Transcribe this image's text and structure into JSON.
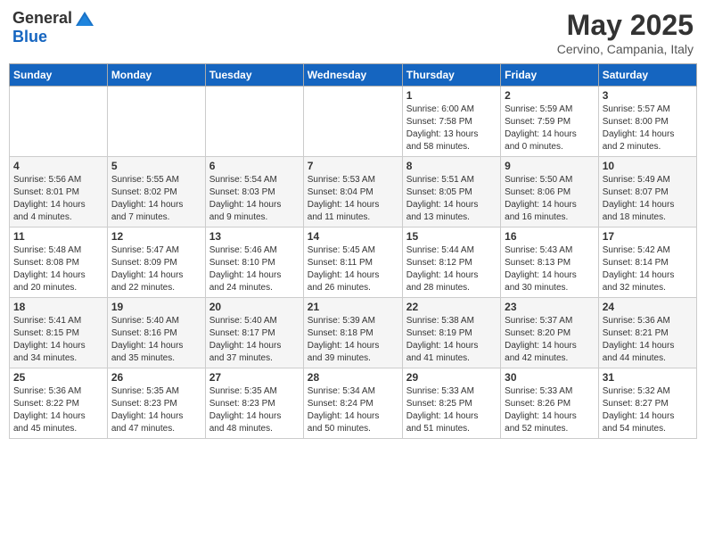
{
  "header": {
    "logo_general": "General",
    "logo_blue": "Blue",
    "month": "May 2025",
    "location": "Cervino, Campania, Italy"
  },
  "days_of_week": [
    "Sunday",
    "Monday",
    "Tuesday",
    "Wednesday",
    "Thursday",
    "Friday",
    "Saturday"
  ],
  "weeks": [
    [
      {
        "num": "",
        "info": ""
      },
      {
        "num": "",
        "info": ""
      },
      {
        "num": "",
        "info": ""
      },
      {
        "num": "",
        "info": ""
      },
      {
        "num": "1",
        "info": "Sunrise: 6:00 AM\nSunset: 7:58 PM\nDaylight: 13 hours\nand 58 minutes."
      },
      {
        "num": "2",
        "info": "Sunrise: 5:59 AM\nSunset: 7:59 PM\nDaylight: 14 hours\nand 0 minutes."
      },
      {
        "num": "3",
        "info": "Sunrise: 5:57 AM\nSunset: 8:00 PM\nDaylight: 14 hours\nand 2 minutes."
      }
    ],
    [
      {
        "num": "4",
        "info": "Sunrise: 5:56 AM\nSunset: 8:01 PM\nDaylight: 14 hours\nand 4 minutes."
      },
      {
        "num": "5",
        "info": "Sunrise: 5:55 AM\nSunset: 8:02 PM\nDaylight: 14 hours\nand 7 minutes."
      },
      {
        "num": "6",
        "info": "Sunrise: 5:54 AM\nSunset: 8:03 PM\nDaylight: 14 hours\nand 9 minutes."
      },
      {
        "num": "7",
        "info": "Sunrise: 5:53 AM\nSunset: 8:04 PM\nDaylight: 14 hours\nand 11 minutes."
      },
      {
        "num": "8",
        "info": "Sunrise: 5:51 AM\nSunset: 8:05 PM\nDaylight: 14 hours\nand 13 minutes."
      },
      {
        "num": "9",
        "info": "Sunrise: 5:50 AM\nSunset: 8:06 PM\nDaylight: 14 hours\nand 16 minutes."
      },
      {
        "num": "10",
        "info": "Sunrise: 5:49 AM\nSunset: 8:07 PM\nDaylight: 14 hours\nand 18 minutes."
      }
    ],
    [
      {
        "num": "11",
        "info": "Sunrise: 5:48 AM\nSunset: 8:08 PM\nDaylight: 14 hours\nand 20 minutes."
      },
      {
        "num": "12",
        "info": "Sunrise: 5:47 AM\nSunset: 8:09 PM\nDaylight: 14 hours\nand 22 minutes."
      },
      {
        "num": "13",
        "info": "Sunrise: 5:46 AM\nSunset: 8:10 PM\nDaylight: 14 hours\nand 24 minutes."
      },
      {
        "num": "14",
        "info": "Sunrise: 5:45 AM\nSunset: 8:11 PM\nDaylight: 14 hours\nand 26 minutes."
      },
      {
        "num": "15",
        "info": "Sunrise: 5:44 AM\nSunset: 8:12 PM\nDaylight: 14 hours\nand 28 minutes."
      },
      {
        "num": "16",
        "info": "Sunrise: 5:43 AM\nSunset: 8:13 PM\nDaylight: 14 hours\nand 30 minutes."
      },
      {
        "num": "17",
        "info": "Sunrise: 5:42 AM\nSunset: 8:14 PM\nDaylight: 14 hours\nand 32 minutes."
      }
    ],
    [
      {
        "num": "18",
        "info": "Sunrise: 5:41 AM\nSunset: 8:15 PM\nDaylight: 14 hours\nand 34 minutes."
      },
      {
        "num": "19",
        "info": "Sunrise: 5:40 AM\nSunset: 8:16 PM\nDaylight: 14 hours\nand 35 minutes."
      },
      {
        "num": "20",
        "info": "Sunrise: 5:40 AM\nSunset: 8:17 PM\nDaylight: 14 hours\nand 37 minutes."
      },
      {
        "num": "21",
        "info": "Sunrise: 5:39 AM\nSunset: 8:18 PM\nDaylight: 14 hours\nand 39 minutes."
      },
      {
        "num": "22",
        "info": "Sunrise: 5:38 AM\nSunset: 8:19 PM\nDaylight: 14 hours\nand 41 minutes."
      },
      {
        "num": "23",
        "info": "Sunrise: 5:37 AM\nSunset: 8:20 PM\nDaylight: 14 hours\nand 42 minutes."
      },
      {
        "num": "24",
        "info": "Sunrise: 5:36 AM\nSunset: 8:21 PM\nDaylight: 14 hours\nand 44 minutes."
      }
    ],
    [
      {
        "num": "25",
        "info": "Sunrise: 5:36 AM\nSunset: 8:22 PM\nDaylight: 14 hours\nand 45 minutes."
      },
      {
        "num": "26",
        "info": "Sunrise: 5:35 AM\nSunset: 8:23 PM\nDaylight: 14 hours\nand 47 minutes."
      },
      {
        "num": "27",
        "info": "Sunrise: 5:35 AM\nSunset: 8:23 PM\nDaylight: 14 hours\nand 48 minutes."
      },
      {
        "num": "28",
        "info": "Sunrise: 5:34 AM\nSunset: 8:24 PM\nDaylight: 14 hours\nand 50 minutes."
      },
      {
        "num": "29",
        "info": "Sunrise: 5:33 AM\nSunset: 8:25 PM\nDaylight: 14 hours\nand 51 minutes."
      },
      {
        "num": "30",
        "info": "Sunrise: 5:33 AM\nSunset: 8:26 PM\nDaylight: 14 hours\nand 52 minutes."
      },
      {
        "num": "31",
        "info": "Sunrise: 5:32 AM\nSunset: 8:27 PM\nDaylight: 14 hours\nand 54 minutes."
      }
    ]
  ]
}
